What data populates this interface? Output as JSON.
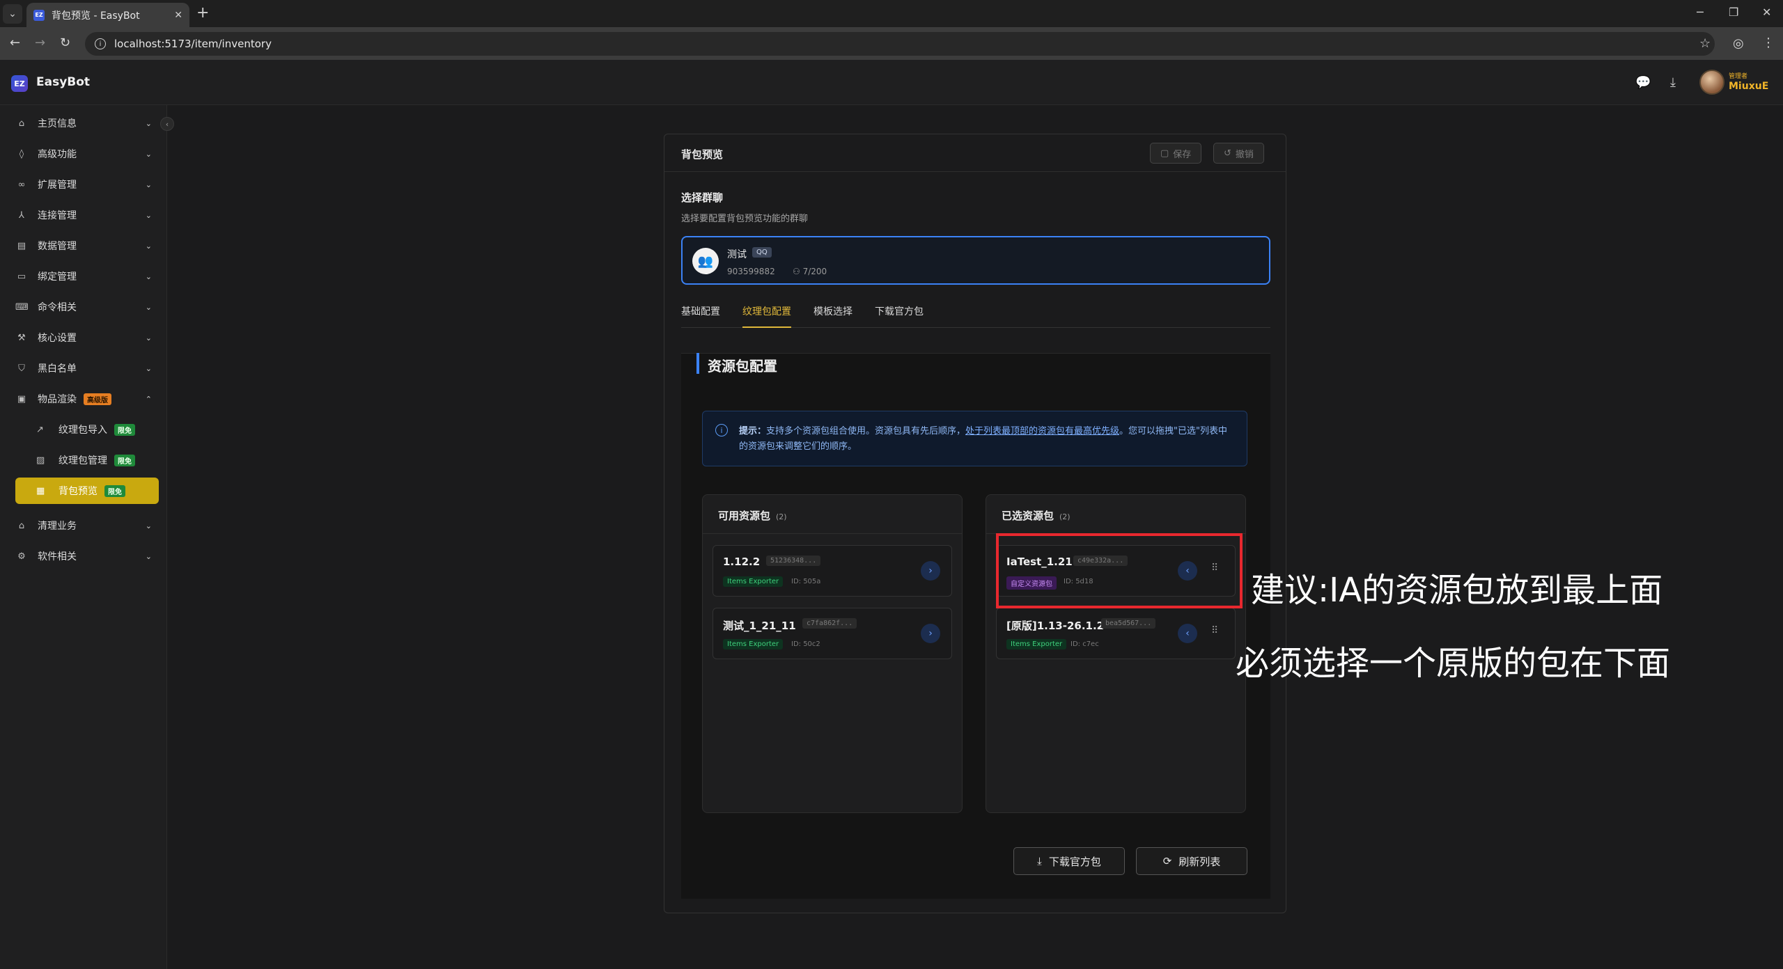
{
  "browser": {
    "tab_title": "背包预览 - EasyBot",
    "favicon_text": "EZ",
    "url": "localhost:5173/item/inventory"
  },
  "app": {
    "logo_text": "EZ",
    "name": "EasyBot",
    "user": {
      "tag": "管理者",
      "name": "MiuxuE"
    }
  },
  "sidebar": {
    "items": [
      {
        "label": "主页信息",
        "icon": "home-icon"
      },
      {
        "label": "高级功能",
        "icon": "flame-icon"
      },
      {
        "label": "扩展管理",
        "icon": "link-icon"
      },
      {
        "label": "连接管理",
        "icon": "network-icon"
      },
      {
        "label": "数据管理",
        "icon": "database-icon"
      },
      {
        "label": "绑定管理",
        "icon": "id-card-icon"
      },
      {
        "label": "命令相关",
        "icon": "terminal-icon"
      },
      {
        "label": "核心设置",
        "icon": "wrench-icon"
      },
      {
        "label": "黑白名单",
        "icon": "shield-icon"
      },
      {
        "label": "物品渲染",
        "icon": "package-icon",
        "badge": "高级版"
      },
      {
        "label": "清理业务",
        "icon": "broom-icon"
      },
      {
        "label": "软件相关",
        "icon": "gear-icon"
      }
    ],
    "subitems": [
      {
        "label": "纹理包导入",
        "badge": "限免",
        "icon": "import-icon"
      },
      {
        "label": "纹理包管理",
        "badge": "限免",
        "icon": "image-icon"
      },
      {
        "label": "背包预览",
        "badge": "限免",
        "icon": "grid-icon",
        "active": true
      }
    ]
  },
  "panel": {
    "title": "背包预览",
    "save_label": "保存",
    "undo_label": "撤销",
    "group_section_title": "选择群聊",
    "group_section_sub": "选择要配置背包预览功能的群聊",
    "group": {
      "name": "测试",
      "platform": "QQ",
      "id": "903599882",
      "members": "7/200"
    },
    "tabs": [
      "基础配置",
      "纹理包配置",
      "模板选择",
      "下载官方包"
    ],
    "active_tab": "纹理包配置",
    "rp_title": "资源包配置",
    "tip": {
      "label": "提示：",
      "text1": "支持多个资源包组合使用。资源包具有先后顺序，",
      "link": "处于列表最顶部的资源包有最高优先级",
      "text2": "。您可以拖拽\"已选\"列表中的资源包来调整它们的顺序。"
    },
    "available": {
      "title": "可用资源包",
      "count": "(2)",
      "packs": [
        {
          "name": "1.12.2",
          "hash": "51236348...",
          "tag": "Items Exporter",
          "id": "ID: 505a"
        },
        {
          "name": "测试_1_21_11",
          "hash": "c7fa862f...",
          "tag": "Items Exporter",
          "id": "ID: 50c2"
        }
      ]
    },
    "selected": {
      "title": "已选资源包",
      "count": "(2)",
      "packs": [
        {
          "name": "IaTest_1.21",
          "hash": "c49e332a...",
          "tag": "自定义资源包",
          "id": "ID: 5d18"
        },
        {
          "name": "[原版]1.13-26.1.2",
          "hash": "bea5d567...",
          "tag": "Items Exporter",
          "id": "ID: c7ec"
        }
      ]
    },
    "download_label": "下载官方包",
    "refresh_label": "刷新列表"
  },
  "annotations": {
    "line1": "建议:IA的资源包放到最上面",
    "line2": "必须选择一个原版的包在下面"
  },
  "colors": {
    "accent_blue": "#3b82f6",
    "active_gold": "#c9a90f",
    "annotation_red": "#e8282e"
  }
}
